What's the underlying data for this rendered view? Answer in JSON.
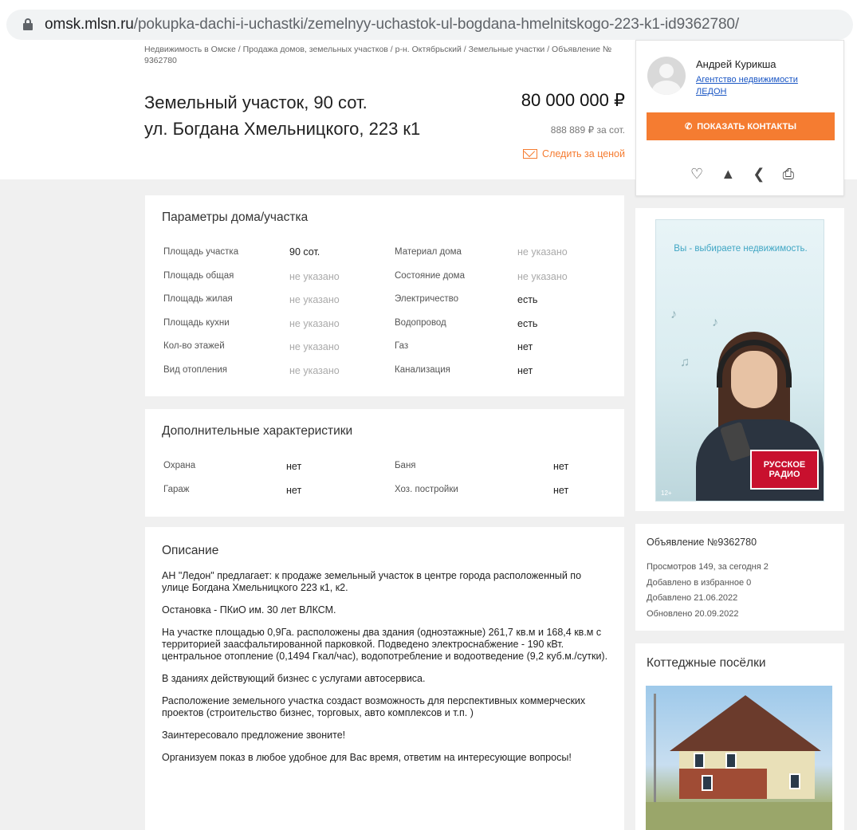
{
  "browser": {
    "url_domain": "omsk.mlsn.ru",
    "url_path": "/pokupka-dachi-i-uchastki/zemelnyy-uchastok-ul-bogdana-hmelnitskogo-223-k1-id9362780/"
  },
  "breadcrumb": "Недвижимость в Омске / Продажа домов, земельных участков / р-н. Октябрьский / Земельные участки / Объявление № 9362780",
  "listing": {
    "title_line1": "Земельный участок, 90 сот.",
    "title_line2": "ул. Богдана Хмельницкого, 223 к1",
    "price": "80 000 000 ₽",
    "price_per_unit": "888 889 ₽ за сот.",
    "watch_price": "Следить за ценой"
  },
  "contact": {
    "name": "Андрей Курикша",
    "agency": "Агентство недвижимости ЛЕДОН",
    "show_contacts": "ПОКАЗАТЬ КОНТАКТЫ",
    "icons": [
      "heart-icon",
      "warning-icon",
      "share-icon",
      "print-icon"
    ]
  },
  "params": {
    "title": "Параметры дома/участка",
    "rows": [
      {
        "l1": "Площадь участка",
        "v1": "90 сот.",
        "l2": "Материал дома",
        "v2": "не указано"
      },
      {
        "l1": "Площадь общая",
        "v1": "не указано",
        "l2": "Состояние дома",
        "v2": "не указано"
      },
      {
        "l1": "Площадь жилая",
        "v1": "не указано",
        "l2": "Электричество",
        "v2": "есть"
      },
      {
        "l1": "Площадь кухни",
        "v1": "не указано",
        "l2": "Водопровод",
        "v2": "есть"
      },
      {
        "l1": "Кол-во этажей",
        "v1": "не указано",
        "l2": "Газ",
        "v2": "нет"
      },
      {
        "l1": "Вид отопления",
        "v1": "не указано",
        "l2": "Канализация",
        "v2": "нет"
      }
    ]
  },
  "extra": {
    "title": "Дополнительные характеристики",
    "rows": [
      {
        "l1": "Охрана",
        "v1": "нет",
        "l2": "Баня",
        "v2": "нет"
      },
      {
        "l1": "Гараж",
        "v1": "нет",
        "l2": "Хоз. постройки",
        "v2": "нет"
      }
    ]
  },
  "description": {
    "title": "Описание",
    "paragraphs": [
      "АН \"Ледон\" предлагает: к продаже земельный участок в центре города расположенный по улице Богдана Хмельницкого 223 к1, к2.",
      "Остановка - ПКиО им. 30 лет ВЛКСМ.",
      "На участке площадью 0,9Га. расположены два здания (одноэтажные) 261,7 кв.м и 168,4 кв.м с территорией заасфальтированной парковкой. Подведено электроснабжение - 190 кВт. центральное отопление (0,1494 Гкал/час), водопотребление и водоотведение (9,2 куб.м./сутки).",
      "В зданиях действующий бизнес с услугами автосервиса.",
      "Расположение земельного участка создаст возможность для перспективных коммерческих проектов (строительство бизнес, торговых, авто комплексов и т.п. )",
      "Заинтересовало предложение звоните!",
      "Организуем показ в любое удобное для Вас время, ответим на интересующие вопросы!"
    ]
  },
  "ad": {
    "text": "Вы - выбираете недвижимость.",
    "logo": "РУССКОЕ РАДИО",
    "age": "12+"
  },
  "info": {
    "title": "Объявление №9362780",
    "views": "Просмотров 149, за сегодня 2",
    "favorites": "Добавлено в избранное 0",
    "added": "Добавлено 21.06.2022",
    "updated": "Обновлено 20.09.2022"
  },
  "cottages": {
    "title": "Коттеджные посёлки"
  }
}
